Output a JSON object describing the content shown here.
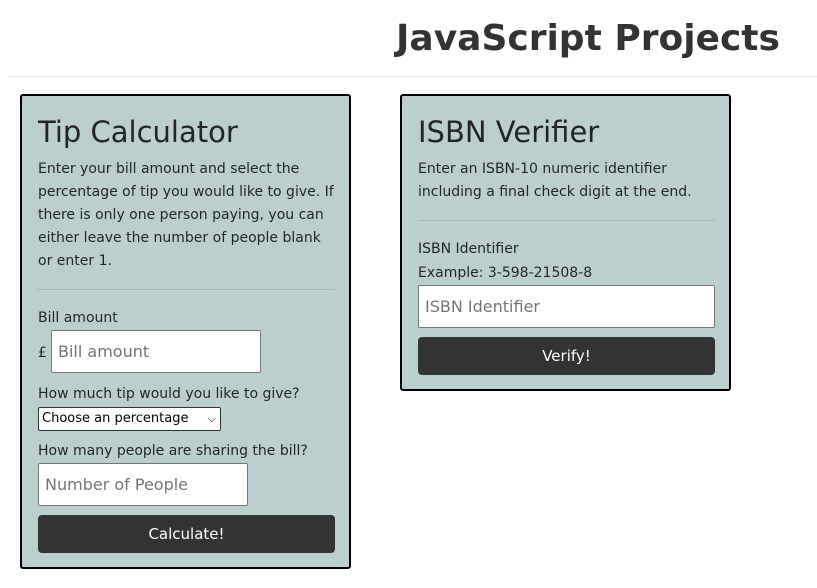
{
  "page": {
    "title": "JavaScript Projects"
  },
  "tip_calculator": {
    "title": "Tip Calculator",
    "description": "Enter your bill amount and select the percentage of tip you would like to give. If there is only one person paying, you can either leave the number of people blank or enter 1.",
    "bill_label": "Bill amount",
    "currency_symbol": "£",
    "bill_placeholder": "Bill amount",
    "bill_value": "",
    "tip_label": "How much tip would you like to give?",
    "tip_select_value": "Choose an percentage",
    "people_label": "How many people are sharing the bill?",
    "people_placeholder": "Number of People",
    "people_value": "",
    "button_label": "Calculate!"
  },
  "isbn_verifier": {
    "title": "ISBN Verifier",
    "description": "Enter an ISBN-10 numeric identifier including a final check digit at the end.",
    "identifier_label": "ISBN Identifier",
    "example_text": "Example: 3-598-21508-8",
    "input_placeholder": "ISBN Identifier",
    "input_value": "",
    "button_label": "Verify!"
  },
  "colors": {
    "card_background": "#bbd0ce",
    "card_border": "#000000",
    "button_background": "#333333",
    "button_text": "#ffffff"
  },
  "icons": {
    "select_arrow": "chevron-down-icon"
  }
}
